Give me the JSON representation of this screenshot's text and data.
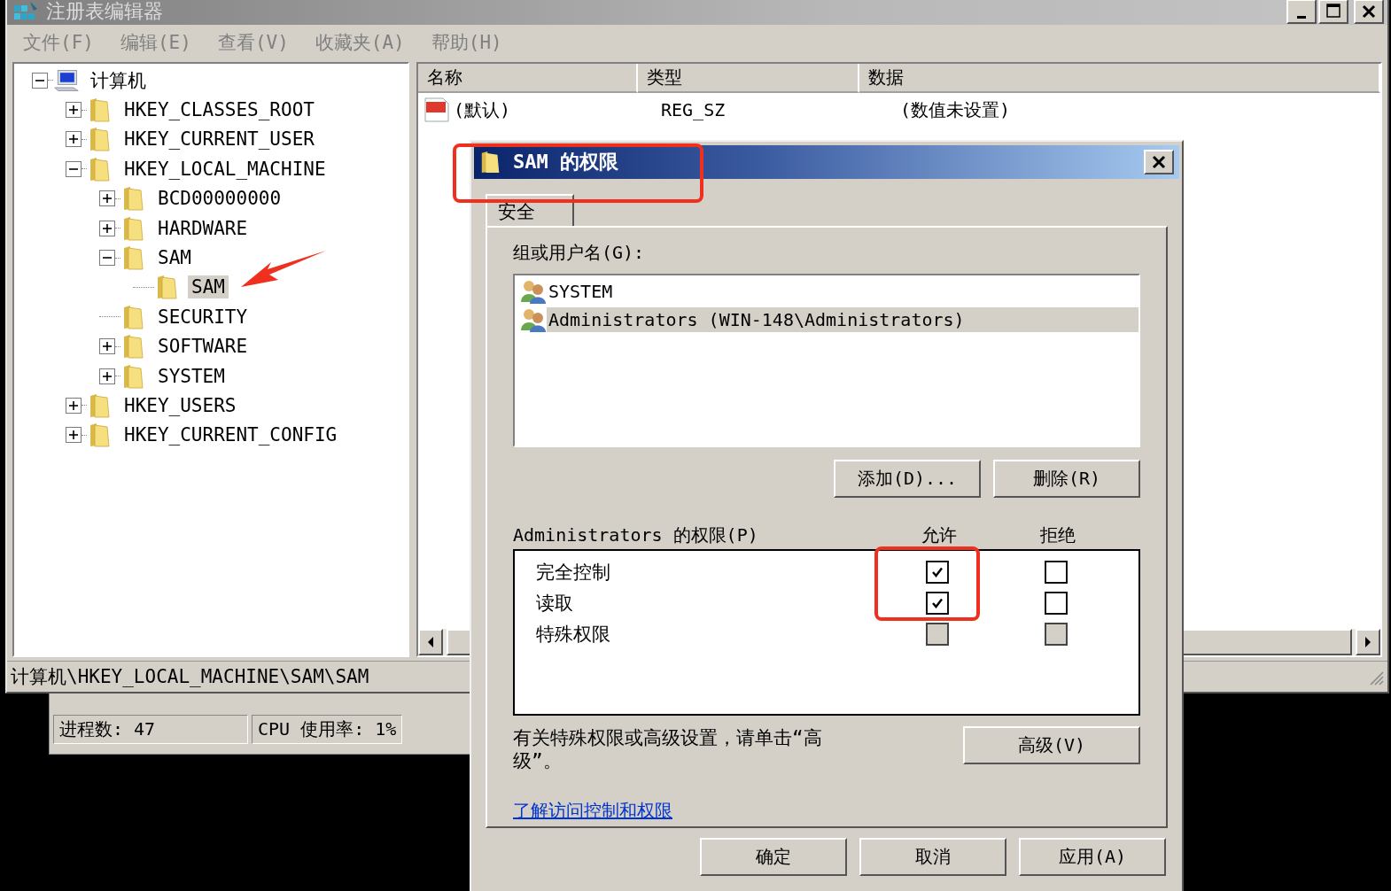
{
  "registry_editor": {
    "title": "注册表编辑器",
    "menu": [
      "文件(F)",
      "编辑(E)",
      "查看(V)",
      "收藏夹(A)",
      "帮助(H)"
    ],
    "tree": [
      {
        "label": "计算机",
        "kind": "computer",
        "expanded": true,
        "selected": false,
        "children": [
          {
            "label": "HKEY_CLASSES_ROOT",
            "kind": "folder",
            "expanded": false,
            "selected": false
          },
          {
            "label": "HKEY_CURRENT_USER",
            "kind": "folder",
            "expanded": false,
            "selected": false
          },
          {
            "label": "HKEY_LOCAL_MACHINE",
            "kind": "folder",
            "expanded": true,
            "selected": false,
            "children": [
              {
                "label": "BCD00000000",
                "kind": "folder",
                "expanded": false,
                "selected": false
              },
              {
                "label": "HARDWARE",
                "kind": "folder",
                "expanded": false,
                "selected": false
              },
              {
                "label": "SAM",
                "kind": "folder",
                "expanded": true,
                "selected": false,
                "children": [
                  {
                    "label": "SAM",
                    "kind": "folder",
                    "selected": true
                  }
                ]
              },
              {
                "label": "SECURITY",
                "kind": "folder",
                "selected": false
              },
              {
                "label": "SOFTWARE",
                "kind": "folder",
                "expanded": false,
                "selected": false
              },
              {
                "label": "SYSTEM",
                "kind": "folder",
                "expanded": false,
                "selected": false
              }
            ]
          },
          {
            "label": "HKEY_USERS",
            "kind": "folder",
            "expanded": false,
            "selected": false
          },
          {
            "label": "HKEY_CURRENT_CONFIG",
            "kind": "folder",
            "expanded": false,
            "selected": false
          }
        ]
      }
    ],
    "list": {
      "columns": [
        "名称",
        "类型",
        "数据"
      ],
      "rows": [
        {
          "name": "(默认)",
          "type": "REG_SZ",
          "data": "(数值未设置)"
        }
      ]
    },
    "status_bar": "计算机\\HKEY_LOCAL_MACHINE\\SAM\\SAM"
  },
  "task_manager": {
    "status": [
      "进程数: 47",
      "CPU 使用率: 1%"
    ]
  },
  "dialog": {
    "title": "SAM 的权限",
    "tabs": [
      {
        "label": "安全",
        "selected": true
      }
    ],
    "groups_label": "组或用户名(G):",
    "principals": [
      {
        "name": "SYSTEM",
        "selected": false
      },
      {
        "name": "Administrators (WIN-148\\Administrators)",
        "selected": true
      }
    ],
    "principal_buttons": [
      "添加(D)...",
      "删除(R)"
    ],
    "permissions_label": "Administrators 的权限(P)",
    "permission_columns": [
      "允许",
      "拒绝"
    ],
    "permissions": [
      {
        "label": "完全控制",
        "allow": {
          "checked": true,
          "disabled": false
        },
        "deny": {
          "checked": false,
          "disabled": false
        }
      },
      {
        "label": "读取",
        "allow": {
          "checked": true,
          "disabled": false
        },
        "deny": {
          "checked": false,
          "disabled": false
        }
      },
      {
        "label": "特殊权限",
        "allow": {
          "checked": false,
          "disabled": true
        },
        "deny": {
          "checked": false,
          "disabled": true
        }
      }
    ],
    "advanced_hint": "有关特殊权限或高级设置，请单击“高级”。",
    "advanced_button": "高级(V)",
    "help_link": "了解访问控制和权限",
    "buttons": [
      "确定",
      "取消",
      "应用(A)"
    ]
  }
}
